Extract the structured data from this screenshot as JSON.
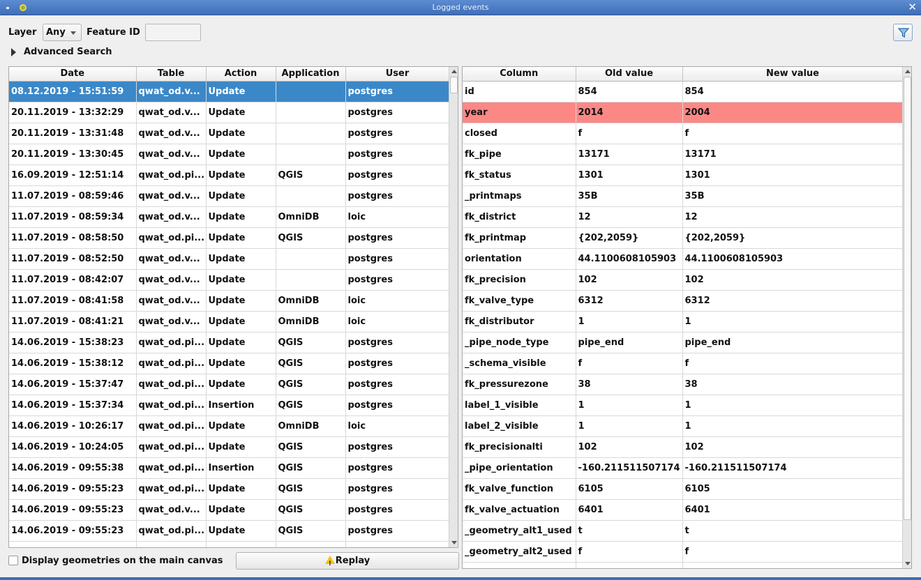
{
  "window": {
    "title": "Logged events",
    "close_glyph": "✕"
  },
  "toolbar": {
    "layer_label": "Layer",
    "layer_value": "Any",
    "feature_id_label": "Feature ID",
    "feature_id_value": "",
    "advanced_search_label": "Advanced Search",
    "filter_icon": "filter-icon"
  },
  "events_table": {
    "columns": [
      "Date",
      "Table",
      "Action",
      "Application",
      "User"
    ],
    "rows": [
      [
        "08.12.2019 - 15:51:59",
        "qwat_od.v...",
        "Update",
        "",
        "postgres"
      ],
      [
        "20.11.2019 - 13:32:29",
        "qwat_od.v...",
        "Update",
        "",
        "postgres"
      ],
      [
        "20.11.2019 - 13:31:48",
        "qwat_od.v...",
        "Update",
        "",
        "postgres"
      ],
      [
        "20.11.2019 - 13:30:45",
        "qwat_od.v...",
        "Update",
        "",
        "postgres"
      ],
      [
        "16.09.2019 - 12:51:14",
        "qwat_od.pi...",
        "Update",
        "QGIS",
        "postgres"
      ],
      [
        "11.07.2019 - 08:59:46",
        "qwat_od.v...",
        "Update",
        "",
        "postgres"
      ],
      [
        "11.07.2019 - 08:59:34",
        "qwat_od.v...",
        "Update",
        "OmniDB",
        "loic"
      ],
      [
        "11.07.2019 - 08:58:50",
        "qwat_od.pi...",
        "Update",
        "QGIS",
        "postgres"
      ],
      [
        "11.07.2019 - 08:52:50",
        "qwat_od.v...",
        "Update",
        "",
        "postgres"
      ],
      [
        "11.07.2019 - 08:42:07",
        "qwat_od.v...",
        "Update",
        "",
        "postgres"
      ],
      [
        "11.07.2019 - 08:41:58",
        "qwat_od.v...",
        "Update",
        "OmniDB",
        "loic"
      ],
      [
        "11.07.2019 - 08:41:21",
        "qwat_od.v...",
        "Update",
        "OmniDB",
        "loic"
      ],
      [
        "14.06.2019 - 15:38:23",
        "qwat_od.pi...",
        "Update",
        "QGIS",
        "postgres"
      ],
      [
        "14.06.2019 - 15:38:12",
        "qwat_od.pi...",
        "Update",
        "QGIS",
        "postgres"
      ],
      [
        "14.06.2019 - 15:37:47",
        "qwat_od.pi...",
        "Update",
        "QGIS",
        "postgres"
      ],
      [
        "14.06.2019 - 15:37:34",
        "qwat_od.pi...",
        "Insertion",
        "QGIS",
        "postgres"
      ],
      [
        "14.06.2019 - 10:26:17",
        "qwat_od.pi...",
        "Update",
        "OmniDB",
        "loic"
      ],
      [
        "14.06.2019 - 10:24:05",
        "qwat_od.pi...",
        "Update",
        "QGIS",
        "postgres"
      ],
      [
        "14.06.2019 - 09:55:38",
        "qwat_od.pi...",
        "Insertion",
        "QGIS",
        "postgres"
      ],
      [
        "14.06.2019 - 09:55:23",
        "qwat_od.pi...",
        "Update",
        "QGIS",
        "postgres"
      ],
      [
        "14.06.2019 - 09:55:23",
        "qwat_od.v...",
        "Update",
        "QGIS",
        "postgres"
      ],
      [
        "14.06.2019 - 09:55:23",
        "qwat_od.pi...",
        "Update",
        "QGIS",
        "postgres"
      ],
      [
        "",
        "",
        "",
        "",
        ""
      ]
    ],
    "selected_index": 0
  },
  "diff_table": {
    "columns": [
      "Column",
      "Old value",
      "New value"
    ],
    "rows": [
      [
        "id",
        "854",
        "854"
      ],
      [
        "year",
        "2014",
        "2004"
      ],
      [
        "closed",
        "f",
        "f"
      ],
      [
        "fk_pipe",
        "13171",
        "13171"
      ],
      [
        "fk_status",
        "1301",
        "1301"
      ],
      [
        "_printmaps",
        "35B",
        "35B"
      ],
      [
        "fk_district",
        "12",
        "12"
      ],
      [
        "fk_printmap",
        "{202,2059}",
        "{202,2059}"
      ],
      [
        "orientation",
        "44.1100608105903",
        "44.1100608105903"
      ],
      [
        "fk_precision",
        "102",
        "102"
      ],
      [
        "fk_valve_type",
        "6312",
        "6312"
      ],
      [
        "fk_distributor",
        "1",
        "1"
      ],
      [
        "_pipe_node_type",
        "pipe_end",
        "pipe_end"
      ],
      [
        "_schema_visible",
        "f",
        "f"
      ],
      [
        "fk_pressurezone",
        "38",
        "38"
      ],
      [
        "label_1_visible",
        "1",
        "1"
      ],
      [
        "label_2_visible",
        "1",
        "1"
      ],
      [
        "fk_precisionalti",
        "102",
        "102"
      ],
      [
        "_pipe_orientation",
        "-160.211511507174",
        "-160.211511507174"
      ],
      [
        "fk_valve_function",
        "6105",
        "6105"
      ],
      [
        "fk_valve_actuation",
        "6401",
        "6401"
      ],
      [
        "_geometry_alt1_used",
        "t",
        "t"
      ],
      [
        "_geometry_alt2_used",
        "f",
        "f"
      ],
      [
        "",
        "",
        ""
      ]
    ],
    "changed_index": 1,
    "changed_color": "#fc8886"
  },
  "footer": {
    "display_geometries_label": "Display geometries on the main canvas",
    "display_geometries_checked": false,
    "replay_label": "Replay",
    "replay_icon": "warning-icon"
  },
  "colors": {
    "selection": "#3b88c8",
    "titlebar": "#3f6fb7"
  }
}
